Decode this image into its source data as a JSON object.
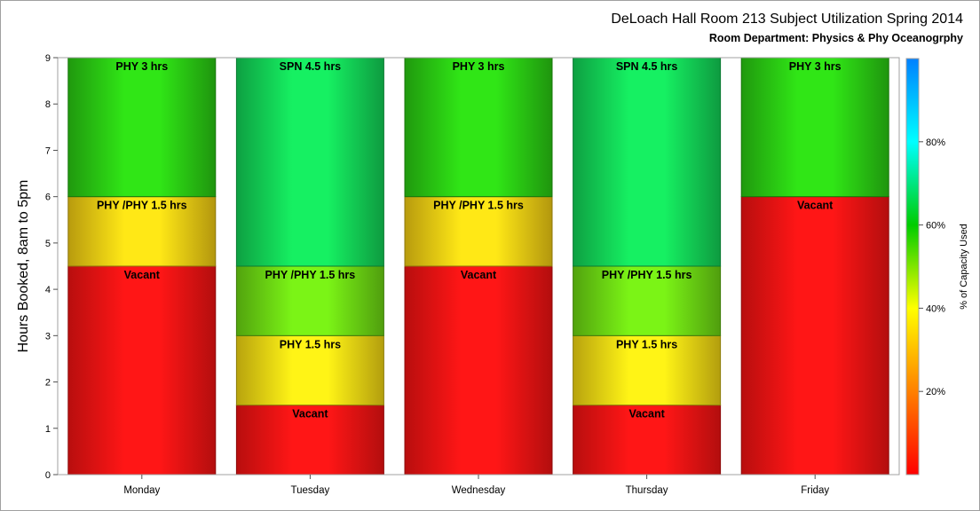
{
  "chart_data": {
    "type": "bar",
    "stacked": true,
    "title": "DeLoach Hall Room 213 Subject Utilization Spring 2014",
    "subtitle": "Room Department:  Physics & Phy Oceanogrphy",
    "xlabel": "",
    "ylabel": "Hours Booked, 8am to 5pm",
    "ylim": [
      0,
      9
    ],
    "yticks": [
      "0",
      "1",
      "2",
      "3",
      "4",
      "5",
      "6",
      "7",
      "8",
      "9"
    ],
    "grid": false,
    "categories": [
      "Monday",
      "Tuesday",
      "Wednesday",
      "Thursday",
      "Friday"
    ],
    "stacks": [
      [
        {
          "label": "Vacant",
          "start": 0,
          "end": 4.5,
          "pct": 0
        },
        {
          "label": "PHY /PHY 1.5 hrs",
          "start": 4.5,
          "end": 6,
          "pct": 33
        },
        {
          "label": "PHY 3 hrs",
          "start": 6,
          "end": 9,
          "pct": 58
        }
      ],
      [
        {
          "label": "Vacant",
          "start": 0,
          "end": 1.5,
          "pct": 0
        },
        {
          "label": "PHY 1.5 hrs",
          "start": 1.5,
          "end": 3,
          "pct": 35
        },
        {
          "label": "PHY /PHY 1.5 hrs",
          "start": 3,
          "end": 4.5,
          "pct": 52
        },
        {
          "label": "SPN 4.5 hrs",
          "start": 4.5,
          "end": 9,
          "pct": 66
        }
      ],
      [
        {
          "label": "Vacant",
          "start": 0,
          "end": 4.5,
          "pct": 0
        },
        {
          "label": "PHY /PHY 1.5 hrs",
          "start": 4.5,
          "end": 6,
          "pct": 33
        },
        {
          "label": "PHY 3 hrs",
          "start": 6,
          "end": 9,
          "pct": 58
        }
      ],
      [
        {
          "label": "Vacant",
          "start": 0,
          "end": 1.5,
          "pct": 0
        },
        {
          "label": "PHY 1.5 hrs",
          "start": 1.5,
          "end": 3,
          "pct": 35
        },
        {
          "label": "PHY /PHY 1.5 hrs",
          "start": 3,
          "end": 4.5,
          "pct": 52
        },
        {
          "label": "SPN 4.5 hrs",
          "start": 4.5,
          "end": 9,
          "pct": 66
        }
      ],
      [
        {
          "label": "Vacant",
          "start": 0,
          "end": 6,
          "pct": 0
        },
        {
          "label": "PHY 3 hrs",
          "start": 6,
          "end": 9,
          "pct": 58
        }
      ]
    ],
    "colorbar": {
      "label": "% of Capacity Used",
      "range": [
        0,
        100
      ],
      "ticks": [
        {
          "value": 20,
          "label": "20%"
        },
        {
          "value": 40,
          "label": "40%"
        },
        {
          "value": 60,
          "label": "60%"
        },
        {
          "value": 80,
          "label": "80%"
        }
      ],
      "gradient": [
        "#ff0000",
        "#ff8000",
        "#ffff00",
        "#00cc00",
        "#00ffff",
        "#0080ff"
      ]
    },
    "colors": {
      "vacant": "#e83838",
      "pct33": "#f07838",
      "pct35": "#f07e38",
      "pct52": "#c8d838",
      "pct58": "#80d838",
      "pct66": "#40c028"
    }
  }
}
